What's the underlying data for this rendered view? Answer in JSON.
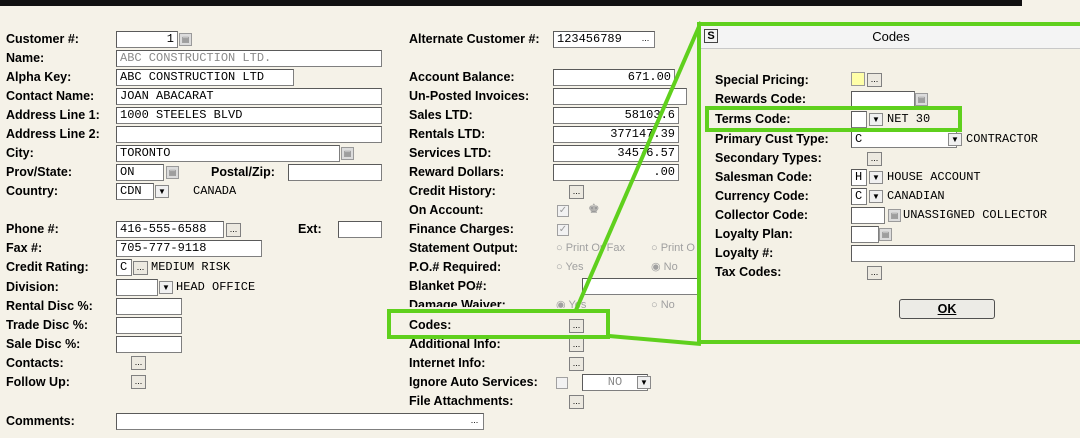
{
  "main": {
    "customer_no_label": "Customer #:",
    "customer_no": "1",
    "name_label": "Name:",
    "name": "ABC CONSTRUCTION LTD.",
    "alpha_key_label": "Alpha Key:",
    "alpha_key": "ABC CONSTRUCTION LTD",
    "contact_name_label": "Contact Name:",
    "contact_name": "JOAN ABACARAT",
    "address1_label": "Address Line 1:",
    "address1": "1000 STEELES BLVD",
    "address2_label": "Address Line 2:",
    "address2": "",
    "city_label": "City:",
    "city": "TORONTO",
    "prov_label": "Prov/State:",
    "prov": "ON",
    "postal_label": "Postal/Zip:",
    "postal": "",
    "country_label": "Country:",
    "country_code": "CDN",
    "country_name": "CANADA",
    "phone_label": "Phone #:",
    "phone": "416-555-6588",
    "ext_label": "Ext:",
    "ext": "",
    "fax_label": "Fax #:",
    "fax": "705-777-9118",
    "credit_rating_label": "Credit Rating:",
    "credit_rating_code": "C",
    "credit_rating_text": "MEDIUM RISK",
    "division_label": "Division:",
    "division": "HEAD OFFICE",
    "rental_disc_label": "Rental Disc %:",
    "trade_disc_label": "Trade Disc %:",
    "sale_disc_label": "Sale Disc %:",
    "contacts_label": "Contacts:",
    "follow_up_label": "Follow Up:",
    "comments_label": "Comments:"
  },
  "right": {
    "alt_customer_label": "Alternate Customer #:",
    "alt_customer": "123456789",
    "account_balance_label": "Account Balance:",
    "account_balance": "671.00",
    "unposted_label": "Un-Posted Invoices:",
    "sales_ltd_label": "Sales LTD:",
    "sales_ltd": "58103.6",
    "rentals_ltd_label": "Rentals LTD:",
    "rentals_ltd": "377147.39",
    "services_ltd_label": "Services LTD:",
    "services_ltd": "34576.57",
    "reward_dollars_label": "Reward Dollars:",
    "reward_dollars": ".00",
    "credit_history_label": "Credit History:",
    "on_account_label": "On Account:",
    "finance_charges_label": "Finance Charges:",
    "statement_output_label": "Statement Output:",
    "statement_opt1": "Print Or Fax",
    "statement_opt2": "Print O",
    "po_required_label": "P.O.# Required:",
    "po_yes": "Yes",
    "po_no": "No",
    "blanket_po_label": "Blanket PO#:",
    "damage_waiver_label": "Damage Waiver:",
    "dw_yes": "Yes",
    "dw_no": "No",
    "codes_label": "Codes:",
    "additional_info_label": "Additional Info:",
    "internet_info_label": "Internet Info:",
    "ignore_auto_label": "Ignore Auto Services:",
    "ignore_auto_value": "NO",
    "file_attachments_label": "File Attachments:"
  },
  "dialog": {
    "title": "Codes",
    "special_pricing_label": "Special Pricing:",
    "rewards_code_label": "Rewards Code:",
    "terms_code_label": "Terms Code:",
    "terms_code_value": "NET 30",
    "primary_cust_label": "Primary Cust Type:",
    "primary_cust_code": "C",
    "primary_cust_text": "CONTRACTOR",
    "secondary_types_label": "Secondary Types:",
    "salesman_label": "Salesman Code:",
    "salesman_code": "H",
    "salesman_text": "HOUSE ACCOUNT",
    "currency_label": "Currency Code:",
    "currency_code": "C",
    "currency_text": "CANADIAN",
    "collector_label": "Collector Code:",
    "collector_text": "UNASSIGNED COLLECTOR",
    "loyalty_plan_label": "Loyalty Plan:",
    "loyalty_no_label": "Loyalty #:",
    "tax_codes_label": "Tax Codes:",
    "ok_label": "OK"
  },
  "colors": {
    "highlight": "#5fd01d",
    "background": "#f5f2e8"
  }
}
